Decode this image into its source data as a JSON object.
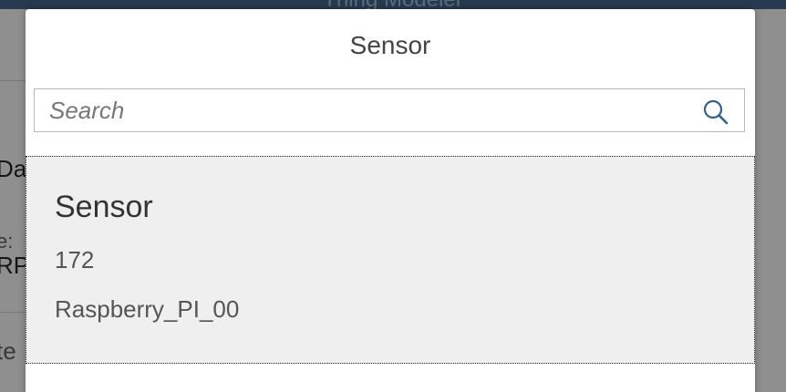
{
  "background": {
    "header_title": "Thing Modeler",
    "fragments": [
      "Da",
      "e:",
      "RPI",
      "te"
    ]
  },
  "dialog": {
    "title": "Sensor",
    "search": {
      "placeholder": "Search",
      "value": ""
    },
    "items": [
      {
        "title": "Sensor",
        "line1": "172",
        "line2": "Raspberry_PI_00"
      }
    ]
  },
  "icons": {
    "search": "search-icon"
  },
  "colors": {
    "accent": "#3d5a7a",
    "list_item_bg": "#efefef",
    "header": "#3d5a7a"
  }
}
